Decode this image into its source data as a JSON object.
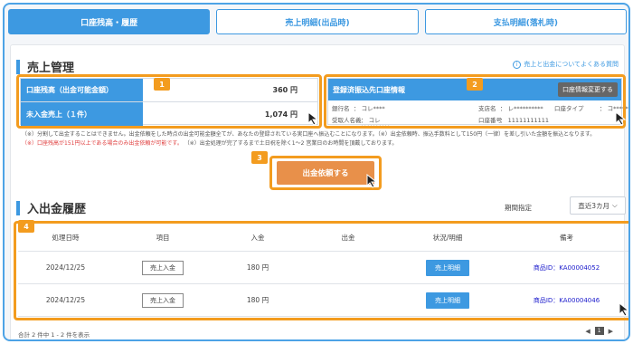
{
  "tabs": [
    {
      "label": "口座残高・履歴"
    },
    {
      "label": "売上明細(出品時)"
    },
    {
      "label": "支払明細(落札時)"
    }
  ],
  "sales": {
    "title": "売上管理",
    "faq": "売上と出金についてよくある質問",
    "balance_label": "口座残高（出金可能金額）",
    "balance_value": "360 円",
    "unpaid_label": "未入金売上（１件）",
    "unpaid_value": "1,074 円"
  },
  "account": {
    "title": "登録済振込先口座情報",
    "change_button": "口座情報変更する",
    "bank_label": "銀行名",
    "bank_value": "： コレ****",
    "branch_label": "支店名",
    "branch_value": "： レ**********",
    "type_label": "口座タイプ",
    "type_value": "： コ**********",
    "holder_label": "受取人名義",
    "holder_value": "： コレ**********",
    "number_label": "口座番号",
    "number_value": "： 11111111111"
  },
  "notes": {
    "line1": "（※）分割して出金することはできません。出金依頼をした時点の出金可能金額全てが、あなたの登録されている実口座へ振込むことになります。（※）出金依頼時、振込手数料として150円（一律）を差し引いた金額を振込となります。",
    "line2_red": "（※）口座残高が151円以上である場合のみ出金依頼が可能です。",
    "line2": "（※）出金処理が完了するまで土日祝を除く1～2 営業日のお時間を頂戴しております。"
  },
  "request_button": "出金依頼する",
  "history": {
    "title": "入出金履歴",
    "period_label": "期間指定",
    "period_value": "直近3カ月",
    "columns": {
      "date": "処理日時",
      "item": "項目",
      "in": "入金",
      "out": "出金",
      "status": "状況/明細",
      "note": "備考"
    },
    "rows": [
      {
        "date": "2024/12/25",
        "item": "売上入金",
        "in": "180 円",
        "out": "",
        "status": "売上明細",
        "note": "商品ID：KA00004052"
      },
      {
        "date": "2024/12/25",
        "item": "売上入金",
        "in": "180 円",
        "out": "",
        "status": "売上明細",
        "note": "商品ID：KA00004046"
      }
    ],
    "footer": "合計 2 件中 1 - 2 件を表示",
    "page": "1"
  },
  "badges": [
    "1",
    "2",
    "3",
    "4"
  ],
  "colors": {
    "accent": "#3d99e1",
    "highlight": "#f39c1f",
    "request": "#e8904a",
    "danger": "#e04040"
  }
}
